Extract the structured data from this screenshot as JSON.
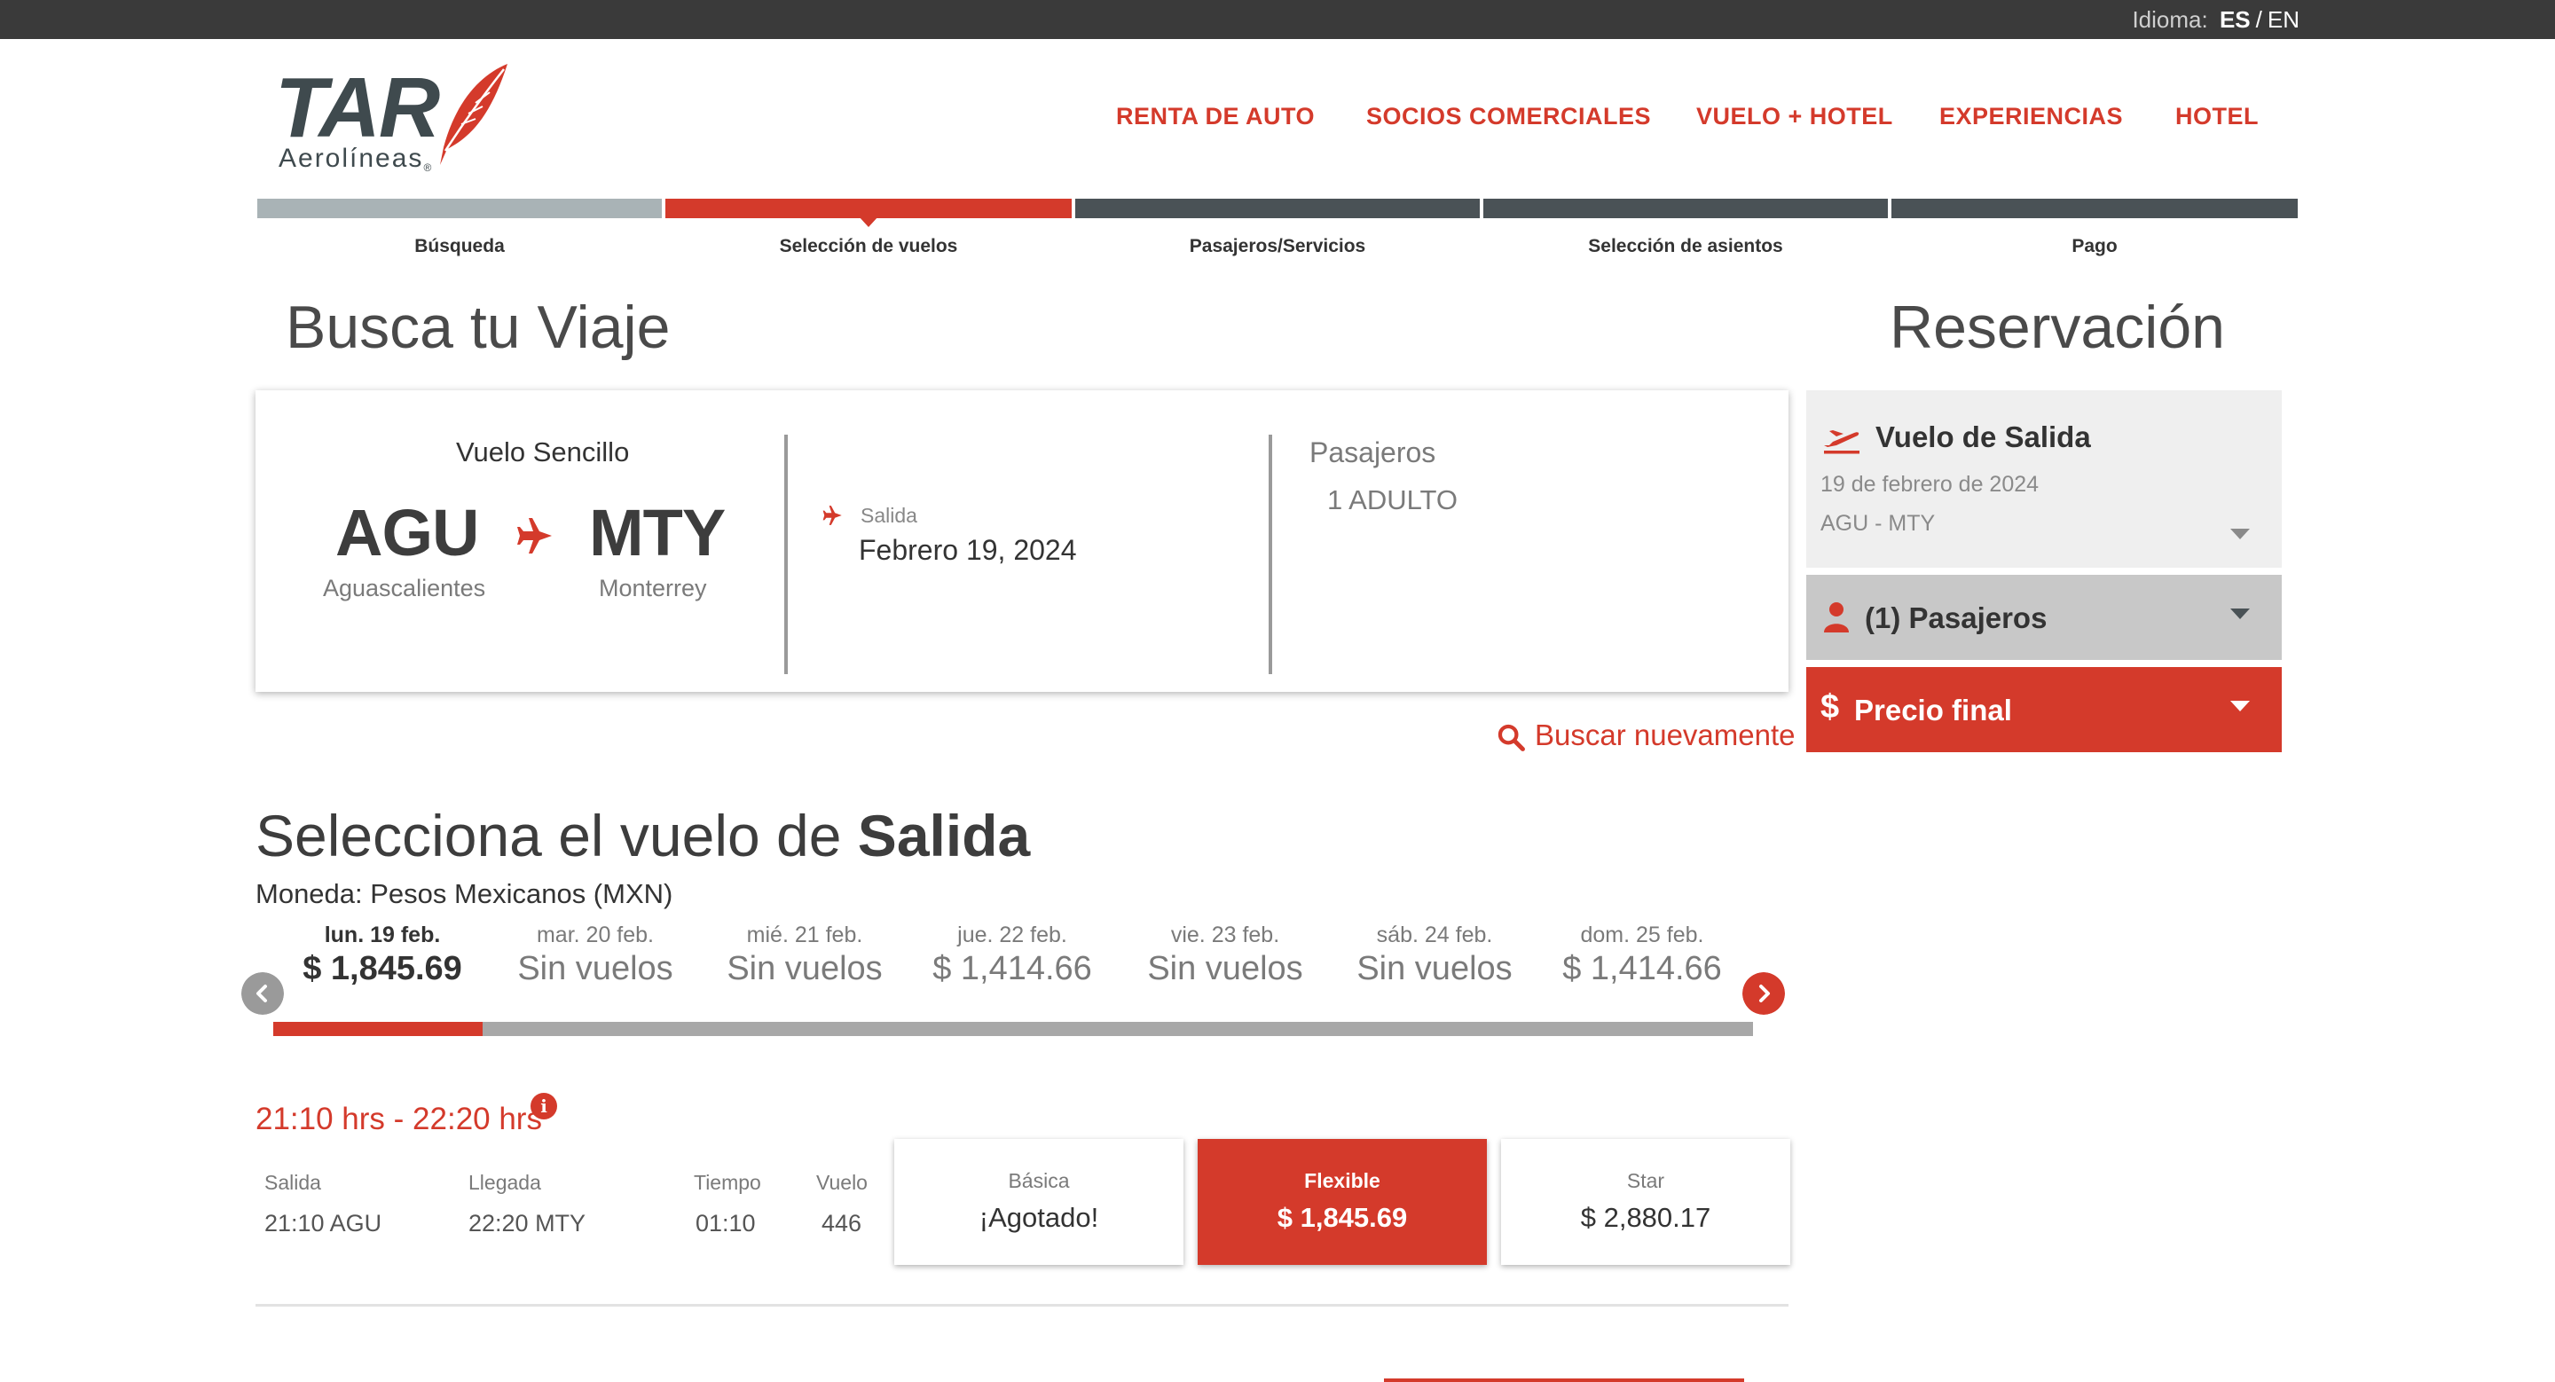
{
  "topbar": {
    "lang_label": "Idioma:",
    "lang_es": "ES",
    "lang_sep": "/",
    "lang_en": "EN"
  },
  "brand": {
    "name": "TAR",
    "subtitle": "Aerolíneas",
    "registered": "®"
  },
  "nav": [
    "RENTA DE AUTO",
    "SOCIOS COMERCIALES",
    "VUELO + HOTEL",
    "EXPERIENCIAS",
    "HOTEL"
  ],
  "steps": [
    {
      "label": "Búsqueda",
      "state": "done"
    },
    {
      "label": "Selección de vuelos",
      "state": "current"
    },
    {
      "label": "Pasajeros/Servicios",
      "state": "pending"
    },
    {
      "label": "Selección de asientos",
      "state": "pending"
    },
    {
      "label": "Pago",
      "state": "pending"
    }
  ],
  "search": {
    "title": "Busca tu Viaje",
    "trip_type": "Vuelo Sencillo",
    "origin_code": "AGU",
    "origin_city": "Aguascalientes",
    "dest_code": "MTY",
    "dest_city": "Monterrey",
    "departure_label": "Salida",
    "departure_date": "Febrero 19, 2024",
    "passengers_label": "Pasajeros",
    "passengers_value": "1 ADULTO",
    "search_again": "Buscar nuevamente"
  },
  "reservation": {
    "title": "Reservación",
    "outbound_title": "Vuelo de Salida",
    "outbound_date": "19 de febrero de 2024",
    "outbound_route": "AGU - MTY",
    "passengers": "(1) Pasajeros",
    "final_price": "Precio final"
  },
  "select": {
    "title_prefix": "Selecciona el vuelo de ",
    "title_bold": "Salida",
    "currency": "Moneda: Pesos Mexicanos (MXN)",
    "days": [
      {
        "day": "lun. 19 feb.",
        "price": "$ 1,845.69",
        "active": true
      },
      {
        "day": "mar. 20 feb.",
        "price": "Sin vuelos",
        "active": false
      },
      {
        "day": "mié. 21 feb.",
        "price": "Sin vuelos",
        "active": false
      },
      {
        "day": "jue. 22 feb.",
        "price": "$ 1,414.66",
        "active": false
      },
      {
        "day": "vie. 23 feb.",
        "price": "Sin vuelos",
        "active": false
      },
      {
        "day": "sáb. 24 feb.",
        "price": "Sin vuelos",
        "active": false
      },
      {
        "day": "dom. 25 feb.",
        "price": "$ 1,414.66",
        "active": false
      }
    ]
  },
  "flight": {
    "time_range": "21:10 hrs - 22:20 hrs",
    "info_icon": "i",
    "headers": {
      "departure": "Salida",
      "arrival": "Llegada",
      "duration": "Tiempo",
      "flight": "Vuelo"
    },
    "values": {
      "departure": "21:10 AGU",
      "arrival": "22:20 MTY",
      "duration": "01:10",
      "flight": "446"
    },
    "fares": [
      {
        "name": "Básica",
        "price": "¡Agotado!",
        "selected": false
      },
      {
        "name": "Flexible",
        "price": "$ 1,845.69",
        "selected": true
      },
      {
        "name": "Star",
        "price": "$ 2,880.17",
        "selected": false
      }
    ]
  },
  "colors": {
    "brand_red": "#d43a2b",
    "dark": "#3a3a3a",
    "step_done": "#a9b3b6",
    "step_pending": "#4a5256"
  },
  "icons": [
    "feather-logo-icon",
    "plane-icon",
    "plane-takeoff-icon",
    "user-icon",
    "dollar-icon",
    "search-icon",
    "chevron-down-icon",
    "chevron-left-icon",
    "chevron-right-icon",
    "info-icon"
  ]
}
